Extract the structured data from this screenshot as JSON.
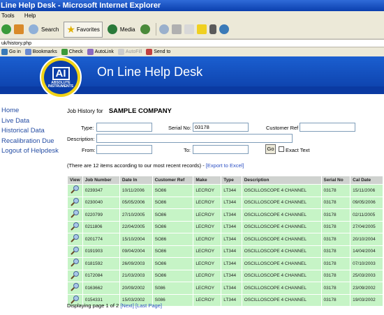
{
  "window": {
    "title": "Line Help Desk - Microsoft Internet Explorer"
  },
  "menu": [
    "Tools",
    "Help"
  ],
  "toolbar": {
    "search_label": "Search",
    "favorites_label": "Favorites",
    "media_label": "Media"
  },
  "address": {
    "url": "uk/history.php"
  },
  "linksbar": {
    "go_label": "Go in",
    "bookmarks_label": "Bookmarks",
    "check_label": "Check",
    "autolink_label": "AutoLink",
    "autofill_label": "AutoFill",
    "sendto_label": "Send to"
  },
  "banner": {
    "title": "On Line Help Desk",
    "logo_mark": "AI",
    "logo_text": "ABSOLUTE INSTRUMENTS"
  },
  "sidebar": {
    "items": [
      "Home",
      "Live Data",
      "Historical Data",
      "Recalibration Due",
      "Logout of Helpdesk"
    ]
  },
  "history": {
    "heading": "Job History for",
    "company": "SAMPLE COMPANY"
  },
  "form": {
    "type_label": "Type:",
    "type_value": "",
    "serial_label": "Serial No:",
    "serial_value": "03178",
    "customer_ref_label": "Customer Ref",
    "customer_ref_value": "",
    "description_label": "Description:",
    "description_value": "",
    "from_label": "From:",
    "from_value": "",
    "to_label": "To:",
    "to_value": "",
    "go_label": "Go",
    "exact_text_label": "Exact Text"
  },
  "results": {
    "note": "(There are 12 items according to our most recent records) - ",
    "export_label": "[Export to Excel]"
  },
  "table": {
    "headers": [
      "View",
      "Job Number",
      "Date In",
      "Customer Ref",
      "Make",
      "Type",
      "Description",
      "Serial No",
      "Cal Date"
    ],
    "rows": [
      [
        "0239347",
        "10/11/2006",
        "SO86",
        "LECROY",
        "LT344",
        "OSCILLOSCOPE 4 CHANNEL",
        "03178",
        "15/11/2006"
      ],
      [
        "0230040",
        "05/05/2006",
        "SO86",
        "LECROY",
        "LT344",
        "OSCILLOSCOPE 4 CHANNEL",
        "03178",
        "09/05/2006"
      ],
      [
        "0220799",
        "27/10/2005",
        "SO86",
        "LECROY",
        "LT344",
        "OSCILLOSCOPE 4 CHANNEL",
        "03178",
        "02/11/2005"
      ],
      [
        "0211806",
        "22/04/2005",
        "SO86",
        "LECROY",
        "LT344",
        "OSCILLOSCOPE 4 CHANNEL",
        "03178",
        "27/04/2005"
      ],
      [
        "0201774",
        "15/10/2004",
        "SO86",
        "LECROY",
        "LT344",
        "OSCILLOSCOPE 4 CHANNEL",
        "03178",
        "20/10/2004"
      ],
      [
        "0191903",
        "09/04/2004",
        "SO86",
        "LECROY",
        "LT344",
        "OSCILLOSCOPE 4 CHANNEL",
        "03178",
        "14/04/2004"
      ],
      [
        "0181592",
        "26/09/2003",
        "SO86",
        "LECROY",
        "LT344",
        "OSCILLOSCOPE 4 CHANNEL",
        "03178",
        "07/10/2003"
      ],
      [
        "0172084",
        "21/03/2003",
        "SO86",
        "LECROY",
        "LT344",
        "OSCILLOSCOPE 4 CHANNEL",
        "03178",
        "25/03/2003"
      ],
      [
        "0163662",
        "20/09/2002",
        "S086",
        "LECROY",
        "LT344",
        "OSCILLOSCOPE 4 CHANNEL",
        "03178",
        "23/09/2002"
      ],
      [
        "0154331",
        "15/03/2002",
        "S086",
        "LECROY",
        "LT344",
        "OSCILLOSCOPE 4 CHANNEL",
        "03178",
        "19/03/2002"
      ]
    ]
  },
  "footer": {
    "text": "Displaying page 1 of 2 ",
    "next_label": "[Next]",
    "last_label": "[Last Page]"
  },
  "colors": {
    "banner": "#1b5fd0",
    "row": "#c6f4c6",
    "header": "#cfd2cf",
    "link": "#244ca3"
  }
}
